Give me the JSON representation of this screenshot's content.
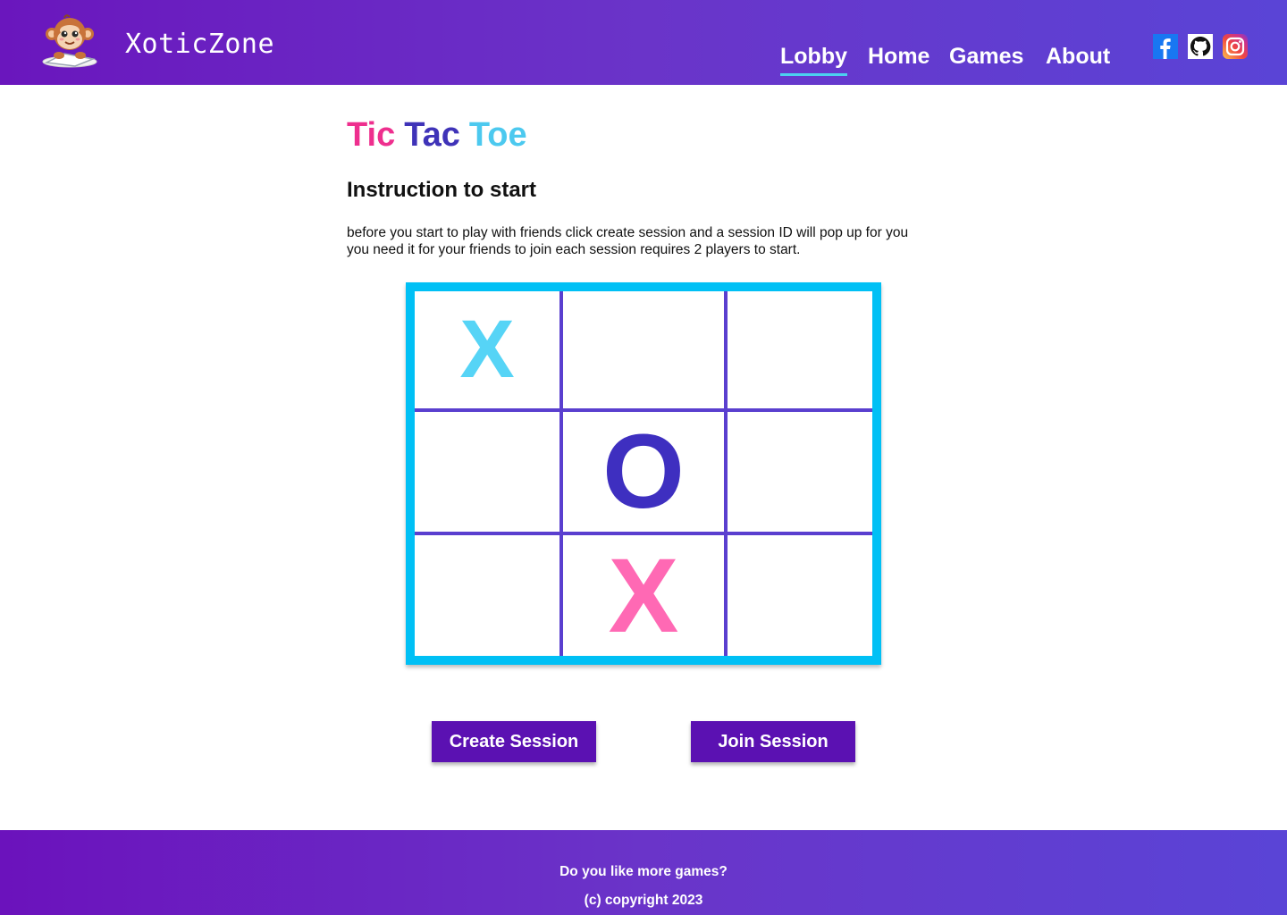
{
  "header": {
    "brand": "XoticZone",
    "nav": [
      {
        "label": "Lobby",
        "active": true
      },
      {
        "label": "Home",
        "active": false
      },
      {
        "label": "Games",
        "active": false
      },
      {
        "label": "About",
        "active": false
      }
    ],
    "social_icons": [
      "facebook-icon",
      "github-icon",
      "instagram-icon"
    ]
  },
  "main": {
    "title_words": [
      {
        "text": "Tic",
        "color": "#ee2f8e"
      },
      {
        "text": "Tac",
        "color": "#3f33b8"
      },
      {
        "text": "Toe",
        "color": "#4cc9ef"
      }
    ],
    "subtitle": "Instruction to start",
    "instructions_line1": "before you start to play with friends click create session and a session ID will  pop up for you",
    "instructions_line2": "you need it for your friends to join each session requires 2 players to start."
  },
  "board": {
    "cells": [
      "X",
      "",
      "",
      "",
      "O",
      "",
      "",
      "X",
      ""
    ],
    "colors": {
      "x_first": "#56d4f6",
      "o": "#3e2fc0",
      "x_second": "#ff69b4",
      "border": "#00c0f5",
      "grid": "#5a3fcf"
    }
  },
  "buttons": {
    "create": "Create Session",
    "join": "Join Session"
  },
  "footer": {
    "line1": "Do you like more games?",
    "line2": "(c) copyright 2023"
  },
  "colors": {
    "button_bg": "#5b11b2",
    "nav_underline": "#4cd0f0"
  }
}
